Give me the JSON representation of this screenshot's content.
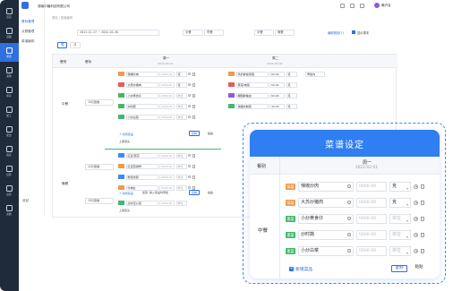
{
  "app": {
    "company": "湖南中膳科技有限公司",
    "user_name": "曦卉名"
  },
  "colors": {
    "accent": "#2f6fe0",
    "nav_bg": "#1f2b3a",
    "overlay_header": "#2f7ef2"
  },
  "nav": {
    "items": [
      {
        "label": "首页",
        "icon": "home-icon"
      },
      {
        "label": "基础",
        "icon": "grid-icon"
      },
      {
        "label": "菜谱",
        "icon": "book-icon"
      },
      {
        "label": "采购",
        "icon": "cart-icon"
      },
      {
        "label": "库存",
        "icon": "box-icon"
      },
      {
        "label": "加工",
        "icon": "factory-icon"
      },
      {
        "label": "配送",
        "icon": "truck-icon"
      },
      {
        "label": "报表",
        "icon": "chart-icon"
      },
      {
        "label": "结算",
        "icon": "money-icon"
      },
      {
        "label": "设置",
        "icon": "gear-icon"
      },
      {
        "label": "系统",
        "icon": "apps-icon"
      }
    ]
  },
  "subnav": {
    "items": [
      "餐标管理",
      "点餐管理",
      "菜谱编排"
    ],
    "footer": "收起"
  },
  "breadcrumb": "首页 / 菜谱编排",
  "filters": {
    "date_range": "2021-11-17 ~ 2022-01-30",
    "select1": "中餐",
    "select2": "早餐",
    "select3": "中餐",
    "select4": "晚餐",
    "link": "编辑规则(7)",
    "checkbox_label": "显示周末"
  },
  "tabs": [
    "周",
    "月"
  ],
  "table": {
    "headers": {
      "meal": "餐别",
      "segment": "餐标"
    },
    "days": [
      {
        "label": "周一",
        "date": "2022-02-01"
      },
      {
        "label": "周二",
        "date": "2022-02-02"
      }
    ],
    "meals": [
      "中餐",
      "晚餐"
    ],
    "segments": [
      "10元套餐",
      "12元套餐",
      "15元套餐"
    ],
    "col1_rows": [
      "辣椒炒肉",
      "大家炒猪肉",
      "小炒黄食仔",
      "炒时蔬",
      "小炒白菜"
    ],
    "col2_rows": [
      "鸡扒鲜饭炖蛋",
      "黄菜/肉菜",
      "糖醋鲜鱼丝",
      "海报炒制菜"
    ],
    "col2_qty": [
      "60.00",
      "50.00",
      "60.00",
      "40.00"
    ],
    "col2_unit": [
      "克",
      "克",
      "克",
      "克"
    ],
    "col1_rows_b": [
      "红豆/葱花",
      "红豆煎排骨",
      "粉烧米腐",
      "牛肉丸"
    ],
    "col1_rows_c": [
      "清炒空心菜"
    ],
    "extra_tag": "早饭内",
    "add_label": "+ 新增菜品",
    "copy_label": "复制",
    "paste_label": "粘贴",
    "publish_label": "上架菜头",
    "note": "加菜: 输入菜品时添加",
    "unit_placeholder": "单位",
    "qty_placeholder": "0000.00",
    "unit_default": "克"
  },
  "overlay": {
    "title": "菜谱设定",
    "meal_header": "餐别",
    "day_label": "周一",
    "day_date": "2022-02-01",
    "meal": "中餐",
    "rows": [
      {
        "tag": "荤菜",
        "tag_color": "#f2994a",
        "dish": "辣椒炒肉",
        "qty": "0000.00",
        "unit": "克"
      },
      {
        "tag": "荤菜",
        "tag_color": "#f2994a",
        "dish": "大苏炒猪肉",
        "qty": "0000.00",
        "unit": "克"
      },
      {
        "tag": "素菜",
        "tag_color": "#43b86c",
        "dish": "小炒黄食仔",
        "qty": "0000.00",
        "unit": "单位"
      },
      {
        "tag": "素菜",
        "tag_color": "#43b86c",
        "dish": "炒时蔬",
        "qty": "0000.00",
        "unit": "单位"
      },
      {
        "tag": "素菜",
        "tag_color": "#43b86c",
        "dish": "小炒白菜",
        "qty": "0000.00",
        "unit": "单位"
      }
    ],
    "add_label": "新增菜品",
    "copy_label": "复制",
    "paste_label": "粘贴"
  }
}
